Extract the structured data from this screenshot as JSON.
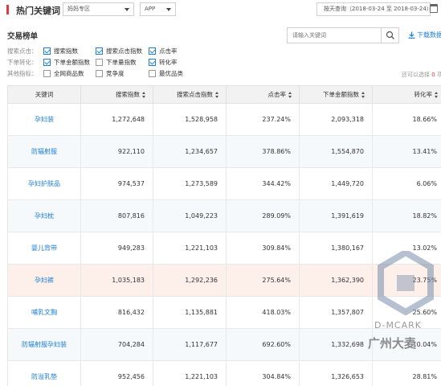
{
  "header": {
    "title": "热门关键词",
    "category_select": "妈妈专区",
    "platform_select": "APP",
    "date_range": "按天查询（2018-03-24 至 2018-03-24）"
  },
  "section": {
    "title": "交易榜单",
    "search_placeholder": "请输入关键词",
    "download_label": "下载数据"
  },
  "filters": [
    {
      "label": "搜索点击：",
      "options": [
        {
          "text": "搜索指数",
          "checked": true
        },
        {
          "text": "搜索点击指数",
          "checked": true
        },
        {
          "text": "点击率",
          "checked": true
        }
      ]
    },
    {
      "label": "下单转化：",
      "options": [
        {
          "text": "下单金额指数",
          "checked": true
        },
        {
          "text": "下单量指数",
          "checked": false
        },
        {
          "text": "转化率",
          "checked": true
        }
      ]
    },
    {
      "label": "其他指标：",
      "options": [
        {
          "text": "全网商品数",
          "checked": false
        },
        {
          "text": "竞争度",
          "checked": false
        },
        {
          "text": "最优品类",
          "checked": false
        }
      ]
    }
  ],
  "remaining": {
    "prefix": "还可以选择",
    "count": "0",
    "suffix": "项"
  },
  "table": {
    "headers": [
      "关键词",
      "搜索指数",
      "搜索点击指数",
      "点击率",
      "下单金额指数",
      "转化率"
    ],
    "rows": [
      [
        "孕妇装",
        "1,272,648",
        "1,528,958",
        "237.24%",
        "2,093,318",
        "18.66%"
      ],
      [
        "防辐射服",
        "922,110",
        "1,234,657",
        "378.86%",
        "1,554,870",
        "13.41%"
      ],
      [
        "孕妇护肤品",
        "974,537",
        "1,273,589",
        "344.42%",
        "1,449,720",
        "6.06%"
      ],
      [
        "孕妇枕",
        "807,816",
        "1,049,223",
        "289.09%",
        "1,391,619",
        "18.82%"
      ],
      [
        "婴儿背带",
        "949,283",
        "1,221,103",
        "309.84%",
        "1,380,167",
        "13.02%"
      ],
      [
        "孕妇裤",
        "1,035,183",
        "1,292,236",
        "275.64%",
        "1,362,390",
        "23.75%"
      ],
      [
        "哺乳文胸",
        "816,432",
        "1,135,881",
        "418.03%",
        "1,357,807",
        "25.60%"
      ],
      [
        "防辐射服孕妇装",
        "704,284",
        "1,117,677",
        "692.60%",
        "1,332,698",
        "10.04%"
      ],
      [
        "防溢乳垫",
        "952,456",
        "1,221,103",
        "304.84%",
        "1,326,653",
        "28.81%"
      ]
    ]
  },
  "watermark": {
    "text": "D-MCARK",
    "text_cn": "广州大麦"
  },
  "colors": {
    "accent": "#e4393c",
    "link": "#1d7fd6",
    "highlight_row": "#fdf0ea"
  }
}
